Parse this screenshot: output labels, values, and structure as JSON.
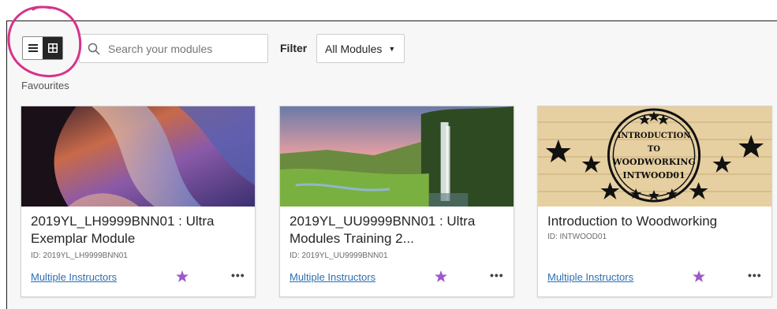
{
  "toolbar": {
    "view_toggle": {
      "list_icon": "list-icon",
      "grid_icon": "grid-icon",
      "active": "grid"
    },
    "search": {
      "placeholder": "Search your modules",
      "icon": "search-icon"
    },
    "filter": {
      "label": "Filter",
      "selected": "All Modules"
    }
  },
  "section": {
    "label": "Favourites"
  },
  "cards": [
    {
      "title": "2019YL_LH9999BNN01 : Ultra Exemplar Module",
      "id_text": "ID: 2019YL_LH9999BNN01",
      "instructors": "Multiple Instructors",
      "favourite": true
    },
    {
      "title": "2019YL_UU9999BNN01 : Ultra Modules Training 2...",
      "id_text": "ID: 2019YL_UU9999BNN01",
      "instructors": "Multiple Instructors",
      "favourite": true
    },
    {
      "title": "Introduction to Woodworking",
      "id_text": "ID: INTWOOD01",
      "instructors": "Multiple Instructors",
      "favourite": true,
      "image_text": [
        "INTRODUCTION",
        "TO",
        "WOODWORKING",
        "INTWOOD01"
      ]
    }
  ],
  "colors": {
    "link": "#2b6fb3",
    "star": "#9b59c9",
    "annotation": "#d6338a"
  }
}
